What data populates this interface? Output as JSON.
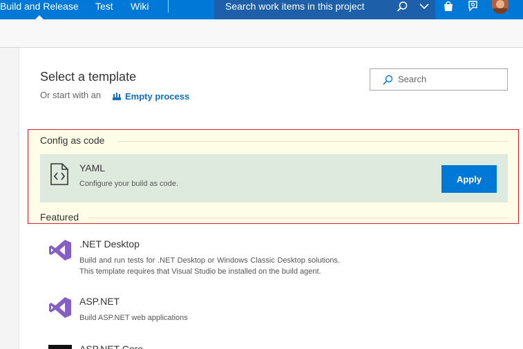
{
  "nav": {
    "items": [
      {
        "label": "Build and Release"
      },
      {
        "label": "Test"
      },
      {
        "label": "Wiki"
      }
    ],
    "search_placeholder": "Search work items in this project"
  },
  "page": {
    "title": "Select a template",
    "start_with": "Or start with an",
    "empty_process": "Empty process",
    "search_placeholder": "Search"
  },
  "sections": {
    "config": {
      "heading": "Config as code",
      "yaml": {
        "title": "YAML",
        "description": "Configure your build as code.",
        "apply_label": "Apply"
      }
    },
    "featured": {
      "heading": "Featured",
      "items": [
        {
          "title": ".NET Desktop",
          "description": "Build and run tests for .NET Desktop or Windows Classic Desktop solutions. This template requires that Visual Studio be installed on the build agent."
        },
        {
          "title": "ASP.NET",
          "description": "Build ASP.NET web applications"
        },
        {
          "title": "ASP.NET Core"
        }
      ]
    }
  },
  "colors": {
    "accent": "#0078d7",
    "link": "#106ebe",
    "highlight_border": "#d9232e",
    "highlight_bg": "#fefee8",
    "card_bg": "#dfeadf",
    "visual_studio": "#865fc5"
  },
  "icons": [
    "search-icon",
    "chevron-down-icon",
    "shopping-bag-icon",
    "feedback-icon",
    "pipeline-icon",
    "file-code-icon",
    "visual-studio-icon",
    "terminal-icon"
  ]
}
